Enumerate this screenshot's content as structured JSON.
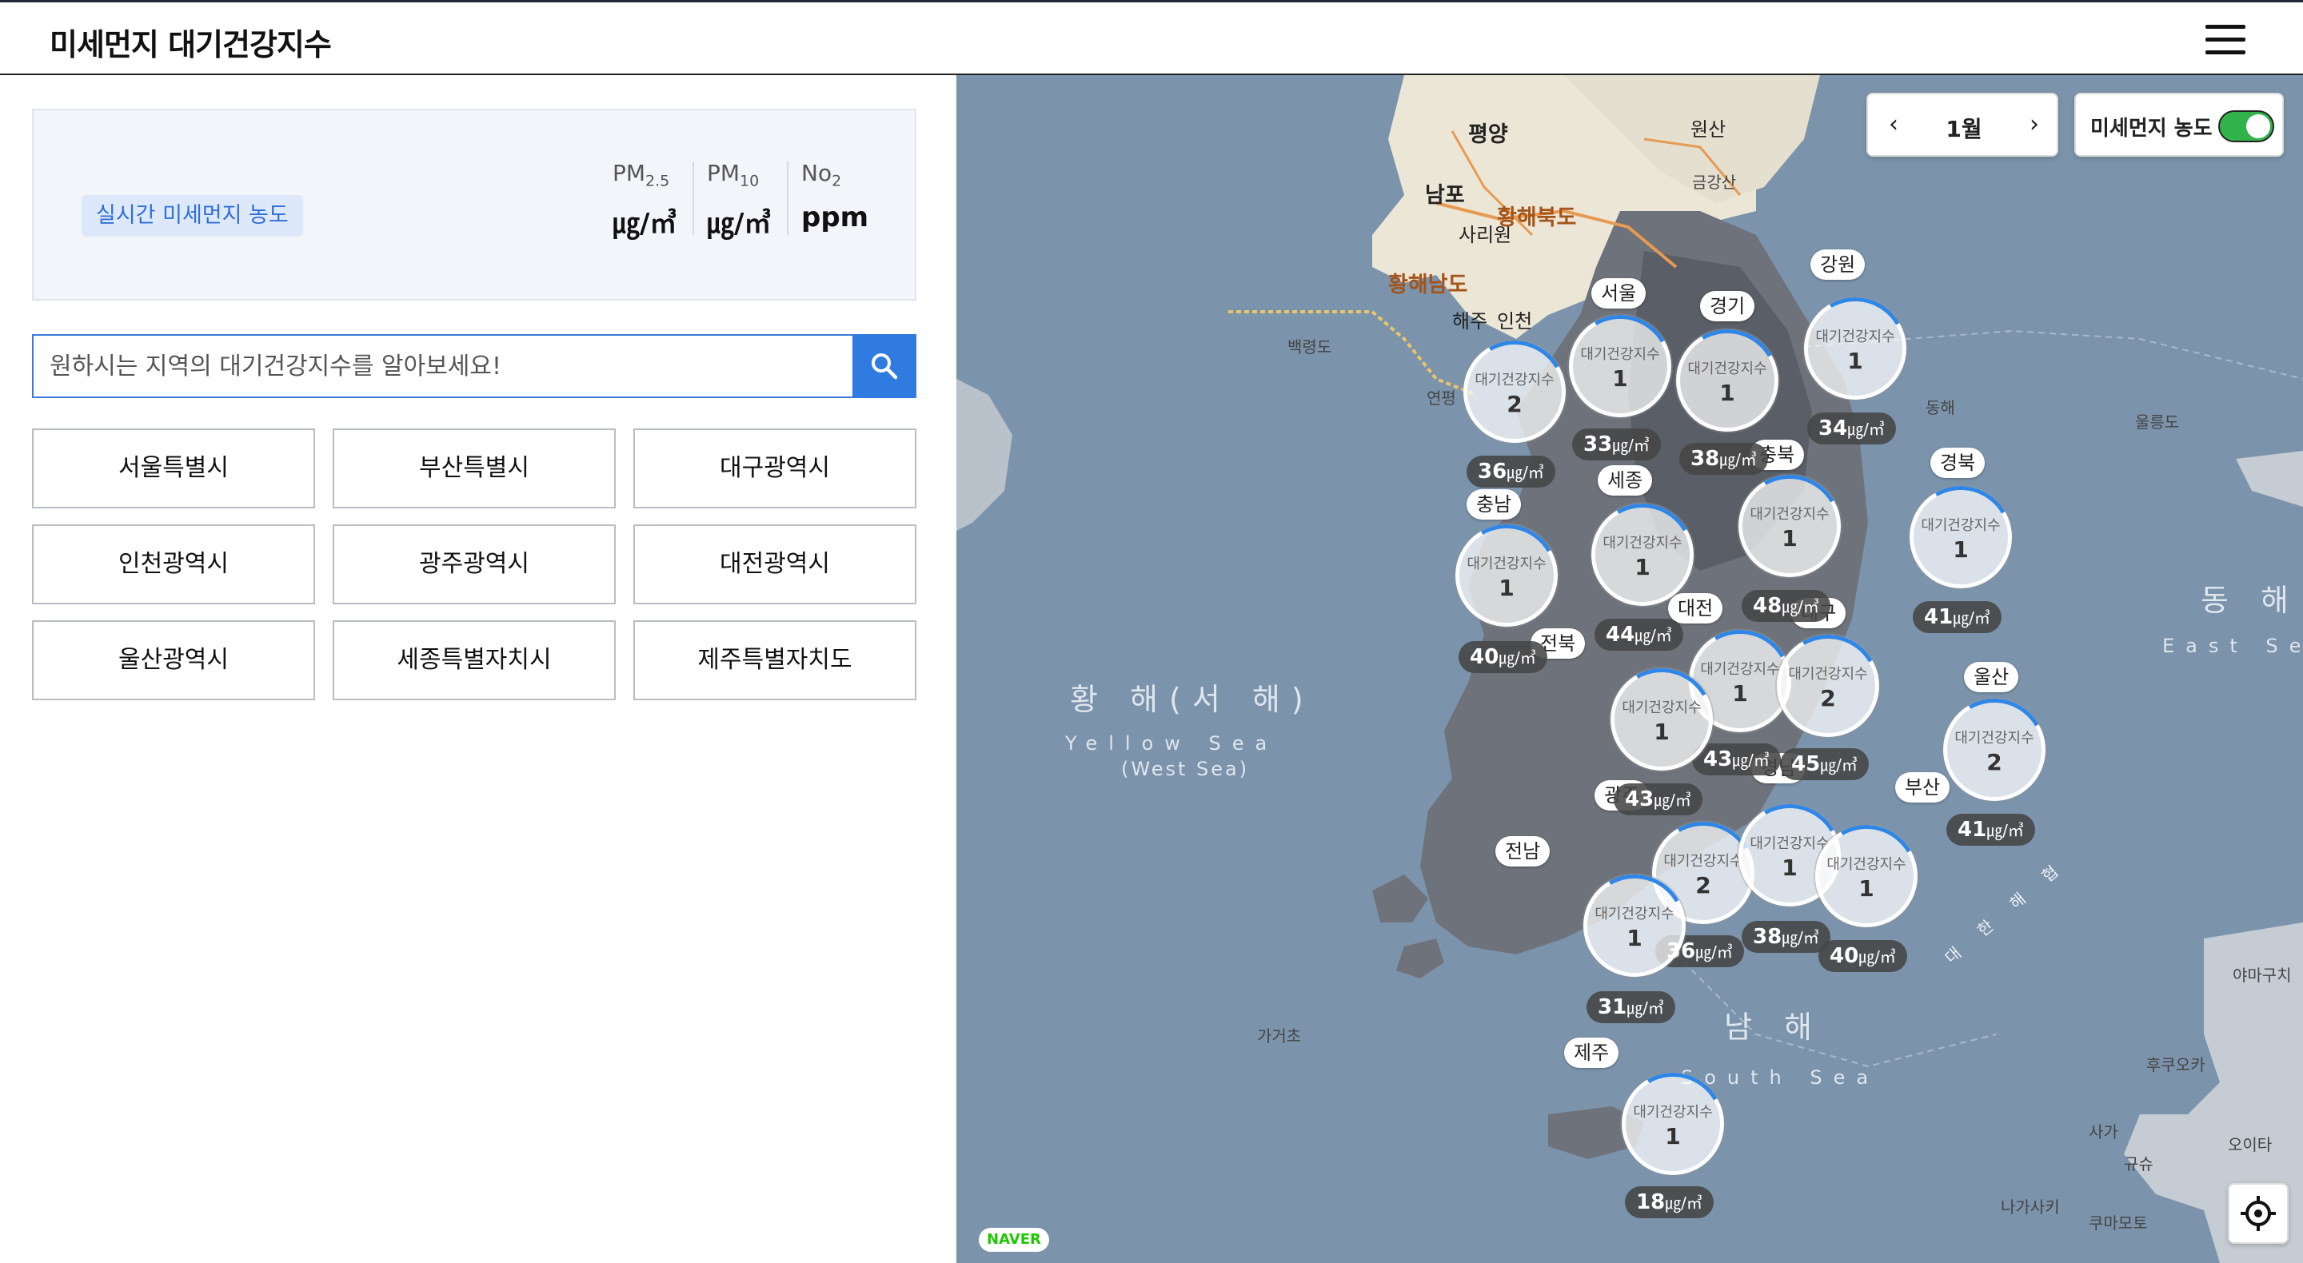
{
  "header": {
    "title": "미세먼지 대기건강지수",
    "menu_icon": "hamburger-menu-icon"
  },
  "legend": {
    "badge": "실시간 미세먼지 농도",
    "units": [
      {
        "name": "PM",
        "sub": "2.5",
        "unit": "㎍/㎥"
      },
      {
        "name": "PM",
        "sub": "10",
        "unit": "㎍/㎥"
      },
      {
        "name": "No",
        "sub": "2",
        "unit": "ppm"
      }
    ]
  },
  "search": {
    "placeholder": "원하시는 지역의 대기건강지수를 알아보세요!",
    "icon": "search-icon"
  },
  "regions": [
    "서울특별시",
    "부산특별시",
    "대구광역시",
    "인천광역시",
    "광주광역시",
    "대전광역시",
    "울산광역시",
    "세종특별자치시",
    "제주특별자치도"
  ],
  "map": {
    "month": "1월",
    "prev_icon": "chevron-left-icon",
    "next_icon": "chevron-right-icon",
    "toggle_label": "미세먼지 농도",
    "toggle_on": true,
    "accent_color": "#2e86e6",
    "toggle_color": "#32b24a",
    "locate_icon": "crosshair-locate-icon",
    "provider": "NAVER",
    "marker_label": "대기건강지수",
    "unit": "㎍/㎥",
    "markers": [
      {
        "region": "서울",
        "index": "1",
        "value": "33"
      },
      {
        "region": "경기",
        "index": "1",
        "value": "38"
      },
      {
        "region": "강원",
        "index": "1",
        "value": "34"
      },
      {
        "region": "인천",
        "index": "2",
        "value": "36"
      },
      {
        "region": "충남",
        "index": "1",
        "value": "40"
      },
      {
        "region": "세종",
        "index": "1",
        "value": "44"
      },
      {
        "region": "충북",
        "index": "1",
        "value": "48"
      },
      {
        "region": "경북",
        "index": "1",
        "value": "41"
      },
      {
        "region": "대전",
        "index": "1",
        "value": "43"
      },
      {
        "region": "대구",
        "index": "2",
        "value": "45"
      },
      {
        "region": "전북",
        "index": "1",
        "value": "43"
      },
      {
        "region": "울산",
        "index": "2",
        "value": "41"
      },
      {
        "region": "광주",
        "index": "2",
        "value": "36"
      },
      {
        "region": "전남",
        "index": "1",
        "value": "31"
      },
      {
        "region": "경남",
        "index": "1",
        "value": "38"
      },
      {
        "region": "부산",
        "index": "1",
        "value": "40"
      },
      {
        "region": "제주",
        "index": "1",
        "value": "18"
      }
    ],
    "labels": {
      "yellow_sea_kr": "황 해(서 해)",
      "yellow_sea_en": "Yellow Sea",
      "yellow_sea_en2": "(West Sea)",
      "east_sea_kr": "동 해",
      "east_sea_en": "East Se",
      "south_sea_kr": "남 해",
      "south_sea_en": "South Sea",
      "strait": "대 한 해 협",
      "pyongyang": "평양",
      "nampo": "남포",
      "sariwon": "사리원",
      "wonsan": "원산",
      "geumgangsan": "금강산",
      "hwanghae_n": "황해북도",
      "hwanghae_s": "황해남도",
      "haeju": "해주",
      "incheon": "인천",
      "baengnyeongdo": "백령도",
      "yeonpyeong": "연평",
      "ulleungdo": "울릉도",
      "donghae": "동해",
      "gageocho": "가거초",
      "yamaguchi": "야마구치",
      "fukuoka": "후쿠오카",
      "saga": "사가",
      "oita": "오이타",
      "nagasaki": "나가사키",
      "kumamoto": "쿠마모토",
      "kyushu": "규슈"
    }
  }
}
